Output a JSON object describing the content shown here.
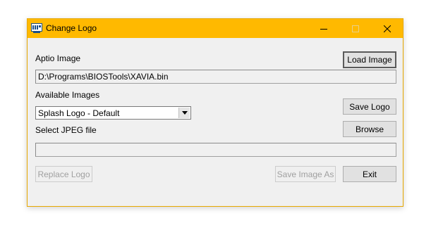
{
  "window": {
    "title": "Change Logo",
    "title_bar_color": "#ffb900",
    "icons": {
      "app": "app-logo-icon",
      "minimize": "minimize-icon",
      "maximize": "maximize-icon",
      "close": "close-icon"
    }
  },
  "aptio": {
    "label": "Aptio Image",
    "path_value": "D:\\Programs\\BIOSTools\\XAVIA.bin",
    "load_button": "Load Image"
  },
  "images": {
    "label": "Available Images",
    "selected": "Splash Logo - Default",
    "save_logo_button": "Save Logo"
  },
  "jpeg": {
    "label": "Select JPEG file",
    "path_value": "",
    "browse_button": "Browse"
  },
  "actions": {
    "replace_logo": "Replace Logo",
    "save_image_as": "Save Image As",
    "exit": "Exit"
  }
}
